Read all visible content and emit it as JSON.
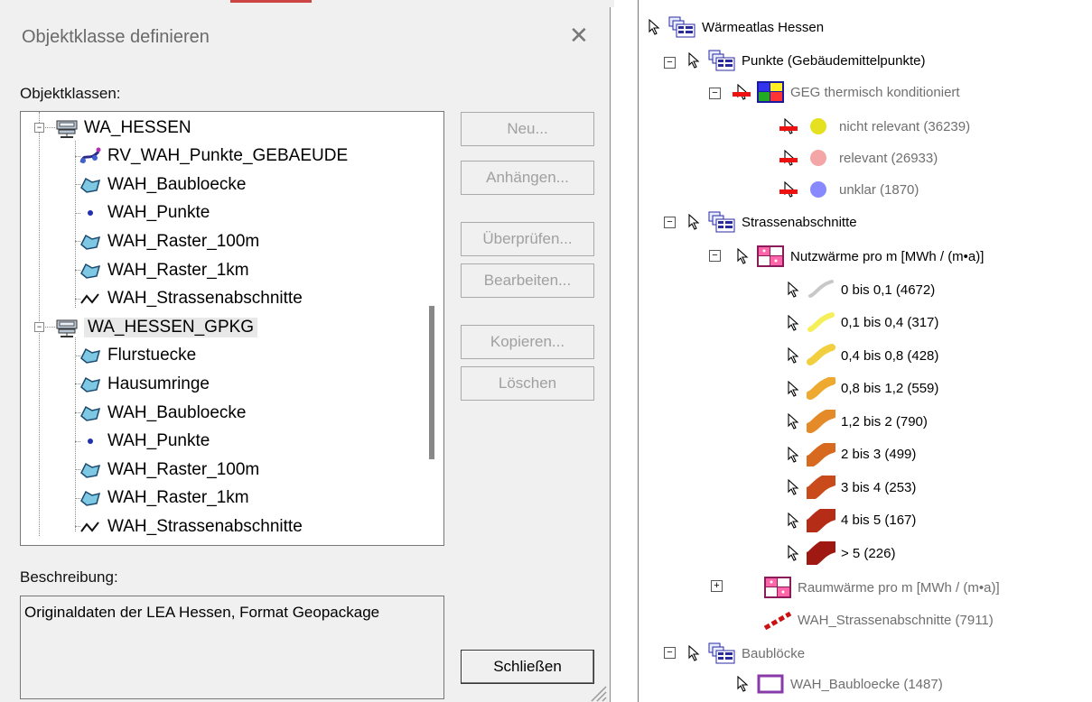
{
  "dialog": {
    "title": "Objektklasse definieren",
    "close_glyph": "✕",
    "classes_label": "Objektklassen:",
    "description_label": "Beschreibung:",
    "description_text": "Originaldaten der LEA Hessen, Format Geopackage",
    "tree": [
      {
        "text": "WA_HESSEN",
        "icon": "database-icon",
        "level": 0
      },
      {
        "text": "RV_WAH_Punkte_GEBAEUDE",
        "icon": "view-icon",
        "level": 1
      },
      {
        "text": "WAH_Baubloecke",
        "icon": "polygon-icon",
        "level": 1
      },
      {
        "text": "WAH_Punkte",
        "icon": "point-icon",
        "level": 1
      },
      {
        "text": "WAH_Raster_100m",
        "icon": "polygon-icon",
        "level": 1
      },
      {
        "text": "WAH_Raster_1km",
        "icon": "polygon-icon",
        "level": 1
      },
      {
        "text": "WAH_Strassenabschnitte",
        "icon": "line-icon",
        "level": 1
      },
      {
        "text": "WA_HESSEN_GPKG",
        "icon": "database-icon",
        "level": 0
      },
      {
        "text": "Flurstuecke",
        "icon": "polygon-icon",
        "level": 1
      },
      {
        "text": "Hausumringe",
        "icon": "polygon-icon",
        "level": 1
      },
      {
        "text": "WAH_Baubloecke",
        "icon": "polygon-icon",
        "level": 1
      },
      {
        "text": "WAH_Punkte",
        "icon": "point-icon",
        "level": 1
      },
      {
        "text": "WAH_Raster_100m",
        "icon": "polygon-icon",
        "level": 1
      },
      {
        "text": "WAH_Raster_1km",
        "icon": "polygon-icon",
        "level": 1
      },
      {
        "text": "WAH_Strassenabschnitte",
        "icon": "line-icon",
        "level": 1
      }
    ],
    "buttons": {
      "new": "Neu...",
      "append": "Anhängen...",
      "check": "Überprüfen...",
      "edit": "Bearbeiten...",
      "copy": "Kopieren...",
      "delete": "Löschen",
      "close": "Schließen"
    }
  },
  "legend": {
    "root": "Wärmeatlas Hessen",
    "points_group": "Punkte (Gebäudemittelpunkte)",
    "geg_layer": "GEG thermisch konditioniert",
    "geg_items": [
      {
        "label": "nicht relevant (36239)",
        "color": "#e5e020"
      },
      {
        "label": "relevant (26933)",
        "color": "#f4a6a6"
      },
      {
        "label": "unklar (1870)",
        "color": "#8888ff"
      }
    ],
    "streets_group": "Strassenabschnitte",
    "nutz_layer": "Nutzwärme pro m [MWh / (m•a)]",
    "nutz_items": [
      {
        "label": "0 bis 0,1 (4672)",
        "color": "#c8c8c8"
      },
      {
        "label": "0,1 bis 0,4 (317)",
        "color": "#f5ef5a"
      },
      {
        "label": "0,4 bis 0,8 (428)",
        "color": "#f2cf3e"
      },
      {
        "label": "0,8 bis 1,2 (559)",
        "color": "#eeaa30"
      },
      {
        "label": "1,2 bis 2 (790)",
        "color": "#e48a28"
      },
      {
        "label": "2 bis 3 (499)",
        "color": "#d86a20"
      },
      {
        "label": "3 bis 4  (253)",
        "color": "#c94a1a"
      },
      {
        "label": "4 bis 5 (167)",
        "color": "#b52d16"
      },
      {
        "label": "> 5 (226)",
        "color": "#a01812"
      }
    ],
    "raum_layer": "Raumwärme pro m [MWh / (m•a)]",
    "wah_streets": "WAH_Strassenabschnitte (7911)",
    "blocks_group": "Baublöcke",
    "wah_blocks": "WAH_Baubloecke (1487)"
  }
}
